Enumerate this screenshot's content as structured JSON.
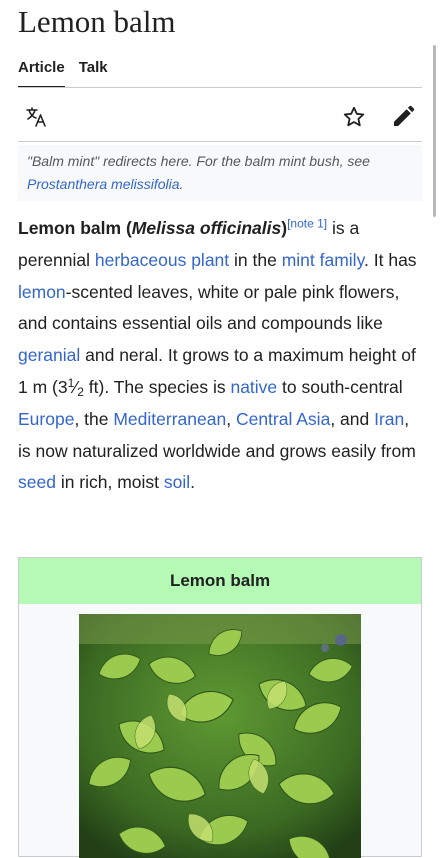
{
  "page": {
    "title": "Lemon balm",
    "tabs": [
      {
        "label": "Article",
        "active": true
      },
      {
        "label": "Talk",
        "active": false
      }
    ]
  },
  "toolbar": {
    "icons": [
      "language-icon",
      "star-icon",
      "edit-pencil-icon"
    ]
  },
  "hatnote": {
    "prefix": "\"Balm mint\" redirects here. For the balm mint bush, see ",
    "link": "Prostanthera melissifolia",
    "suffix": "."
  },
  "intro": {
    "name": "Lemon balm",
    "open_paren": " (",
    "scientific": "Melissa officinalis",
    "close_paren": ")",
    "note": "[note 1]",
    "t1": " is a perennial ",
    "l1": "herbaceous plant",
    "t2": " in the ",
    "l2": "mint family",
    "t3": ". It has ",
    "l3": "lemon",
    "t4": "-scented leaves, white or pale pink flowers, and contains essential oils and compounds like ",
    "l4": "geranial",
    "t5": " and neral. It grows to a maximum height of 1 m (3",
    "frac_num": "1",
    "frac_slash": "⁄",
    "frac_den": "2",
    "t6": " ft). The species is ",
    "l5": "native",
    "t7": " to south-central ",
    "l6": "Europe",
    "t8": ", the ",
    "l7": "Mediterranean",
    "t9": ", ",
    "l8": "Central Asia",
    "t10": ", and ",
    "l9": "Iran",
    "t11": ", is now naturalized worldwide and grows easily from ",
    "l10": "seed",
    "t12": " in rich, moist ",
    "l11": "soil",
    "t13": "."
  },
  "infobox": {
    "title": "Lemon balm",
    "image": "lemon-balm-plant-photo"
  },
  "colors": {
    "link": "#3366cc",
    "text": "#202122",
    "infobox_header": "#b4fab4",
    "hatnote_bg": "#f8f9fa"
  }
}
